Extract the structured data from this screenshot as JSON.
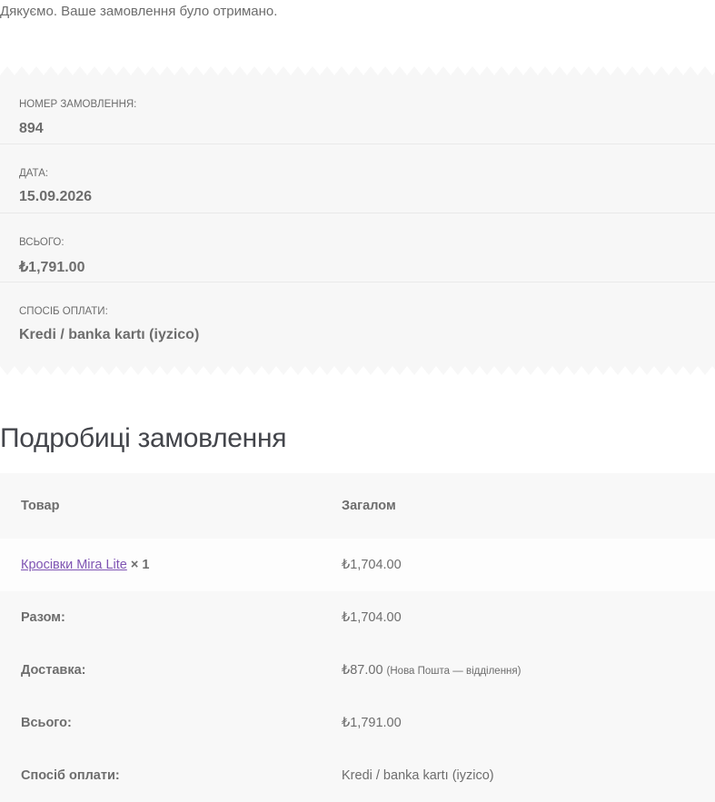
{
  "notice": "Дякуємо. Ваше замовлення було отримано.",
  "overview": {
    "order_number_label": "Номер замовлення:",
    "order_number": "894",
    "date_label": "Дата:",
    "date": "15.09.2026",
    "total_label": "Всього:",
    "total": "₺1,791.00",
    "payment_label": "Спосіб оплати:",
    "payment": "Kredi / banka kartı (iyzico)"
  },
  "details": {
    "title": "Подробиці замовлення",
    "col_product": "Товар",
    "col_total": "Загалом",
    "product_name": "Кросівки Mira Lite",
    "product_qty": "× 1",
    "product_total": "₺1,704.00",
    "subtotal_label": "Разом:",
    "subtotal": "₺1,704.00",
    "shipping_label": "Доставка:",
    "shipping": "₺87.00",
    "shipping_method": "(Нова Пошта — відділення)",
    "grand_total_label": "Всього:",
    "grand_total": "₺1,791.00",
    "payment_label": "Спосіб оплати:",
    "payment": "Kredi / banka kartı (iyzico)"
  },
  "colors": {
    "link": "#7f54b3",
    "panel_bg": "#f7f7f7",
    "text": "#6d6d6d"
  }
}
